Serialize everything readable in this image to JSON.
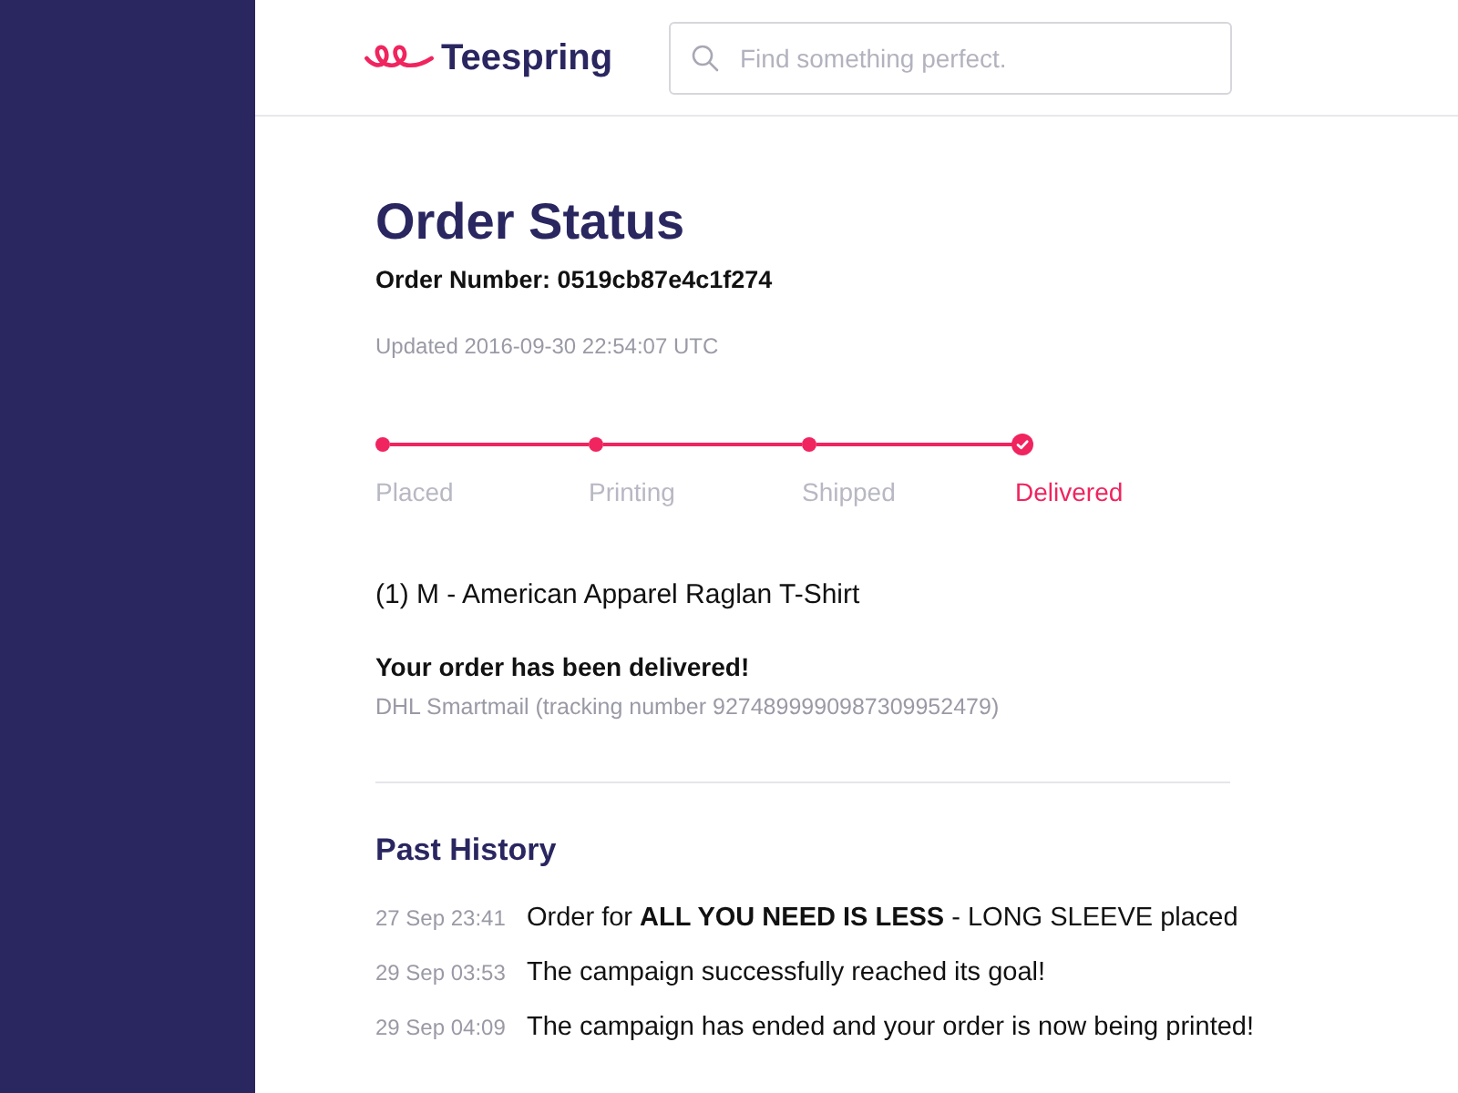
{
  "header": {
    "logo": "Teespring",
    "search": {
      "placeholder": "Find something perfect."
    }
  },
  "order": {
    "title": "Order Status",
    "order_number": "Order Number: 0519cb87e4c1f274",
    "updated": "Updated 2016-09-30 22:54:07 UTC"
  },
  "steps": [
    {
      "label": "Placed",
      "selected": false
    },
    {
      "label": "Printing",
      "selected": false
    },
    {
      "label": "Shipped",
      "selected": false
    },
    {
      "label": "Delivered",
      "selected": true
    }
  ],
  "item": "(1) M - American Apparel Raglan T-Shirt",
  "delivery": {
    "message": "Your order has been delivered!",
    "tracking": "DHL Smartmail (tracking number 9274899990987309952479)"
  },
  "history": {
    "title": "Past History",
    "entries": [
      {
        "time": "27 Sep 23:41",
        "text": "Order for **ALL YOU NEED IS LESS** - LONG SLEEVE placed"
      },
      {
        "time": "29 Sep 03:53",
        "text": "The campaign successfully reached its goal!"
      },
      {
        "time": "29 Sep 04:09",
        "text": "The campaign has ended and your order is now being printed!"
      }
    ]
  }
}
